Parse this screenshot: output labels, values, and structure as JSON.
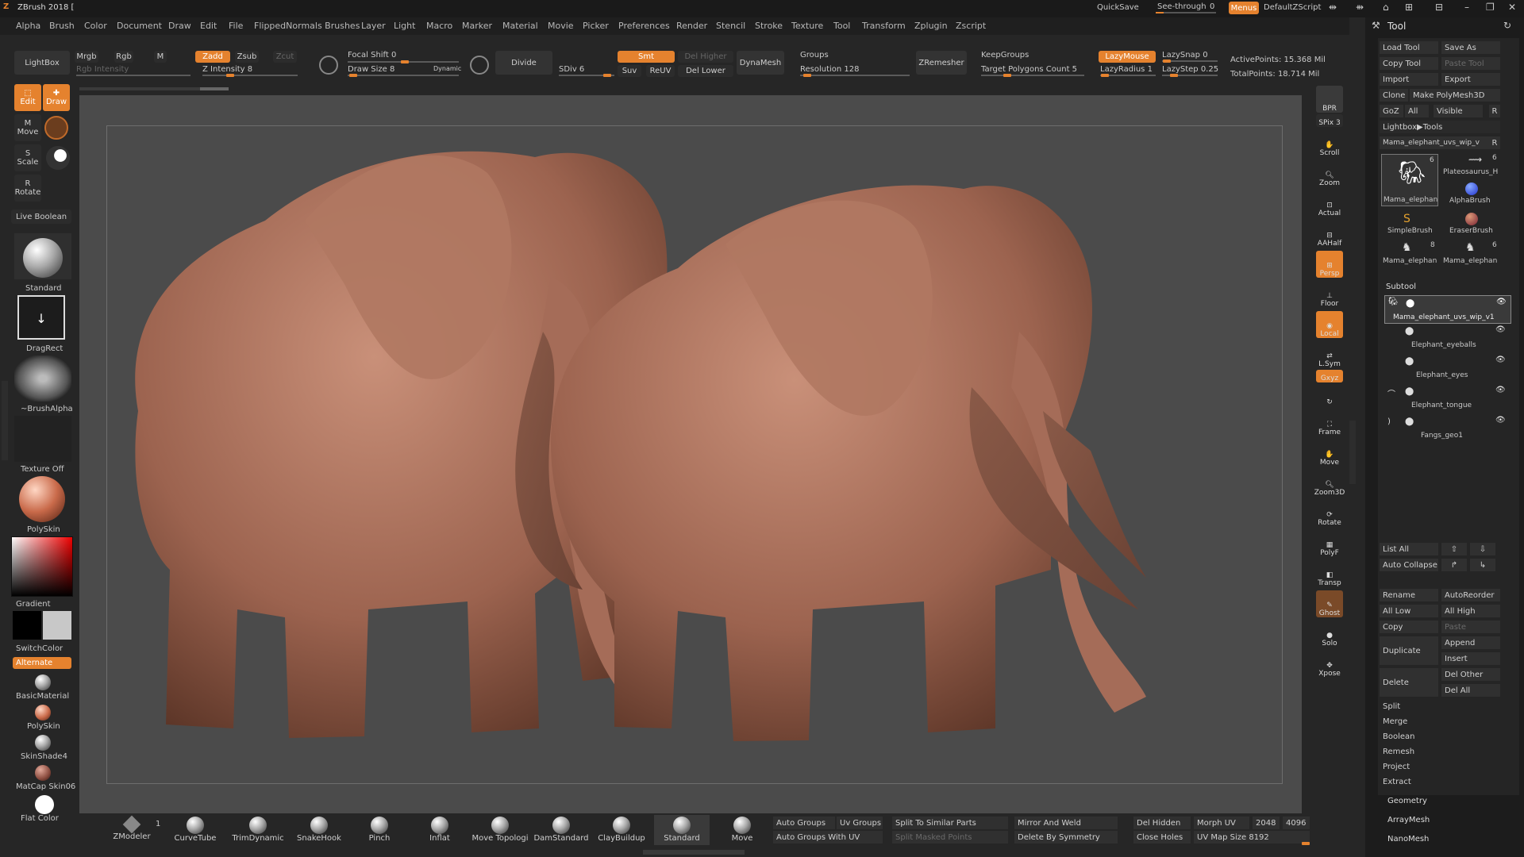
{
  "app": {
    "title": "ZBrush 2018 [",
    "quicksave": "QuickSave",
    "seethrough": "See-through",
    "seethrough_value": "0",
    "menus": "Menus",
    "script": "DefaultZScript"
  },
  "menubar": [
    "Alpha",
    "Brush",
    "Color",
    "Document",
    "Draw",
    "Edit",
    "File",
    "FlippedNormals Brushes",
    "Layer",
    "Light",
    "Macro",
    "Marker",
    "Material",
    "Movie",
    "Picker",
    "Preferences",
    "Render",
    "Stencil",
    "Stroke",
    "Texture",
    "Tool",
    "Transform",
    "Zplugin",
    "Zscript"
  ],
  "topshelf": {
    "lightbox": "LightBox",
    "mrgb": "Mrgb",
    "rgb": "Rgb",
    "m": "M",
    "zadd": "Zadd",
    "zsub": "Zsub",
    "zcut": "Zcut",
    "rgb_intensity": "Rgb Intensity",
    "z_intensity": "Z Intensity 8",
    "focal_shift": "Focal Shift 0",
    "draw_size": "Draw Size 8",
    "dynamic": "Dynamic",
    "divide": "Divide",
    "sdiv": "SDiv 6",
    "smt": "Smt",
    "suv": "Suv",
    "reuv": "ReUV",
    "del_higher": "Del Higher",
    "del_lower": "Del Lower",
    "dynamesh": "DynaMesh",
    "groups": "Groups",
    "resolution": "Resolution 128",
    "zremesher": "ZRemesher",
    "keepgroups": "KeepGroups",
    "target_polygons": "Target Polygons Count 5",
    "lazymouse": "LazyMouse",
    "lazysnap": "LazySnap 0",
    "lazyradius": "LazyRadius 1",
    "lazystep": "LazyStep 0.25",
    "active_points": "ActivePoints: 15.368 Mil",
    "total_points": "TotalPoints: 18.714 Mil"
  },
  "leftbar": {
    "edit": "Edit",
    "draw": "Draw",
    "move": "Move",
    "scale": "Scale",
    "rotate": "Rotate",
    "live_boolean": "Live Boolean",
    "standard": "Standard",
    "dragrect": "DragRect",
    "brushalpha": "~BrushAlpha",
    "texture_off": "Texture Off",
    "polyskin": "PolySkin",
    "gradient": "Gradient",
    "switchcolor": "SwitchColor",
    "alternate": "Alternate",
    "materials": [
      "BasicMaterial",
      "PolySkin",
      "SkinShade4",
      "MatCap Skin06",
      "Flat Color"
    ]
  },
  "rightshelf": [
    "BPR",
    "SPix 3",
    "Scroll",
    "Zoom",
    "Actual",
    "AAHalf",
    "Persp",
    "Floor",
    "Local",
    "L.Sym",
    "Gxyz",
    "Frame",
    "Move",
    "Zoom3D",
    "Rotate",
    "PolyF",
    "Transp",
    "Ghost",
    "Solo",
    "Xpose"
  ],
  "tool_panel": {
    "title": "Tool",
    "load_tool": "Load Tool",
    "save_as": "Save As",
    "copy_tool": "Copy Tool",
    "paste_tool": "Paste Tool",
    "import": "Import",
    "export": "Export",
    "clone": "Clone",
    "make_polymesh": "Make PolyMesh3D",
    "goz": "GoZ",
    "all": "All",
    "visible": "Visible",
    "r": "R",
    "lightbox_tools": "Lightbox▶Tools",
    "current_tool": "Mama_elephant_uvs_wip_v",
    "tools": [
      {
        "name": "Mama_elephan",
        "count": "6"
      },
      {
        "name": "Plateosaurus_H",
        "count": "6"
      },
      {
        "name": "AlphaBrush",
        "count": ""
      },
      {
        "name": "SimpleBrush",
        "count": ""
      },
      {
        "name": "EraserBrush",
        "count": ""
      },
      {
        "name": "Mama_elephan",
        "count": "8"
      },
      {
        "name": "Mama_elephan",
        "count": "6"
      }
    ],
    "subtool_title": "Subtool",
    "subtools": [
      "Mama_elephant_uvs_wip_v1",
      "Elephant_eyeballs",
      "Elephant_eyes",
      "Elephant_tongue",
      "Fangs_geo1"
    ],
    "list_all": "List All",
    "auto_collapse": "Auto Collapse",
    "rename": "Rename",
    "autoreorder": "AutoReorder",
    "all_low": "All Low",
    "all_high": "All High",
    "copy": "Copy",
    "paste": "Paste",
    "duplicate": "Duplicate",
    "append": "Append",
    "insert": "Insert",
    "delete": "Delete",
    "del_other": "Del Other",
    "del_all": "Del All",
    "split": "Split",
    "merge": "Merge",
    "boolean": "Boolean",
    "remesh": "Remesh",
    "project": "Project",
    "extract": "Extract",
    "geometry": "Geometry",
    "arraymesh": "ArrayMesh",
    "nanomesh": "NanoMesh"
  },
  "bottom": {
    "brushes": [
      "ZModeler",
      "CurveTube",
      "TrimDynamic",
      "SnakeHook",
      "Pinch",
      "Inflat",
      "Move Topologi",
      "DamStandard",
      "ClayBuildup",
      "Standard",
      "Move"
    ],
    "zmodeler_count": "1",
    "auto_groups": "Auto Groups",
    "uv_groups": "Uv Groups",
    "split_similar": "Split To Similar Parts",
    "auto_groups_uv": "Auto Groups With UV",
    "split_masked": "Split Masked Points",
    "mirror_weld": "Mirror And Weld",
    "del_by_symmetry": "Delete By Symmetry",
    "del_hidden": "Del Hidden",
    "close_holes": "Close Holes",
    "morph_uv": "Morph UV",
    "uv_2048": "2048",
    "uv_4096": "4096",
    "uv_map_size": "UV Map Size 8192"
  },
  "colors": {
    "accent": "#e5822e",
    "clay": "#b57b62",
    "viewport": "#4b4b4b"
  }
}
